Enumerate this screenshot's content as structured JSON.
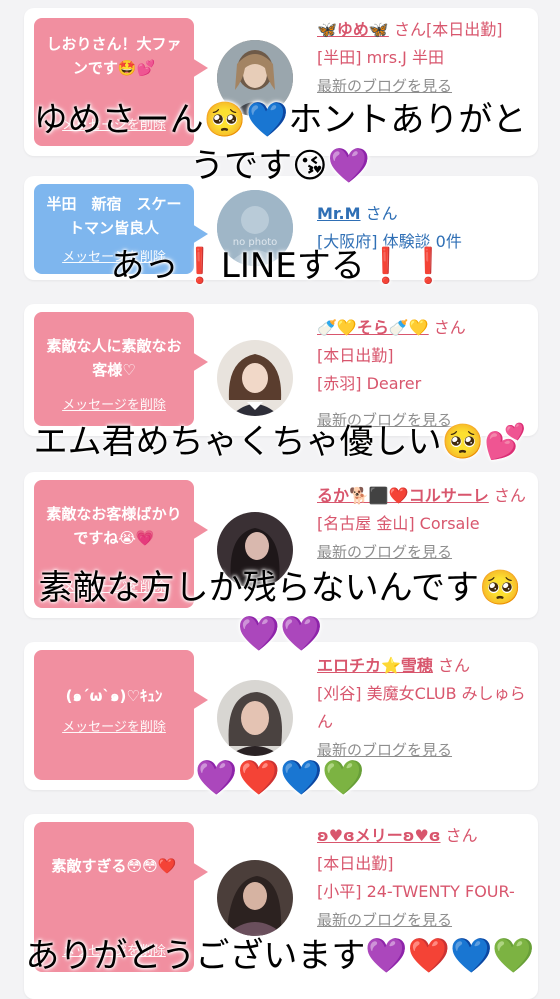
{
  "cards": [
    {
      "bubble_color": "#f18fa0",
      "message": "しおりさん！大ファンです🤩💕",
      "delete_label": "メッセージを削除",
      "name": "🦋ゆめ🦋",
      "san": "さん",
      "status": "[本日出勤]",
      "shop": "[半田] mrs.J 半田",
      "blog_link": "最新のブログを見る"
    },
    {
      "bubble_color": "#7eb6ee",
      "message": "半田　新宿　スケートマン皆良人",
      "delete_label": "メッセージを削除",
      "name": "Mr.M",
      "san": "さん",
      "shop": "[大阪府] 体験談 0件",
      "photo_label": "no photo"
    },
    {
      "bubble_color": "#f18fa0",
      "message": "素敵な人に素敵なお客様♡",
      "delete_label": "メッセージを削除",
      "name": "🍼💛そら🍼💛",
      "san": "さん",
      "status": "[本日出勤]",
      "shop": "[赤羽] Dearer",
      "blog_link": "最新のブログを見る"
    },
    {
      "bubble_color": "#f18fa0",
      "message": "素敵なお客様ばかりですね😭💗",
      "delete_label": "メッセージを削除",
      "name": "るか🐕⬛❤️コルサーレ",
      "san": "さん",
      "shop": "[名古屋 金山] Corsale",
      "blog_link": "最新のブログを見る"
    },
    {
      "bubble_color": "#f18fa0",
      "message": "(๑´ω`๑)♡ｷｭﾝ",
      "delete_label": "メッセージを削除",
      "name": "エロチカ⭐雪穂",
      "san": "さん",
      "shop": "[刈谷] 美魔女CLUB みしゅらん",
      "blog_link": "最新のブログを見る"
    },
    {
      "bubble_color": "#f18fa0",
      "message": "素敵すぎる😳😳❤️",
      "delete_label": "メッセージを削除",
      "name": "ʚ♥ɞメリーʚ♥ɞ",
      "san": "さん",
      "status": "[本日出勤]",
      "shop": "[小平] 24-TWENTY FOUR-",
      "blog_link": "最新のブログを見る"
    }
  ],
  "captions": {
    "c1_line1": "ゆめさーん🥺💙ホントありがと",
    "c1_line2": "うです😘💜",
    "c2": "あっ❗LINEする❗❗",
    "c3": "エム君めちゃくちゃ優しい🥺💕",
    "c4_line1": "素敵な方しか残らないんです🥺",
    "c4_line2": "💜💜",
    "c5": "💜❤️💙💚",
    "c6": "ありがとうございます💜❤️💙💚"
  }
}
